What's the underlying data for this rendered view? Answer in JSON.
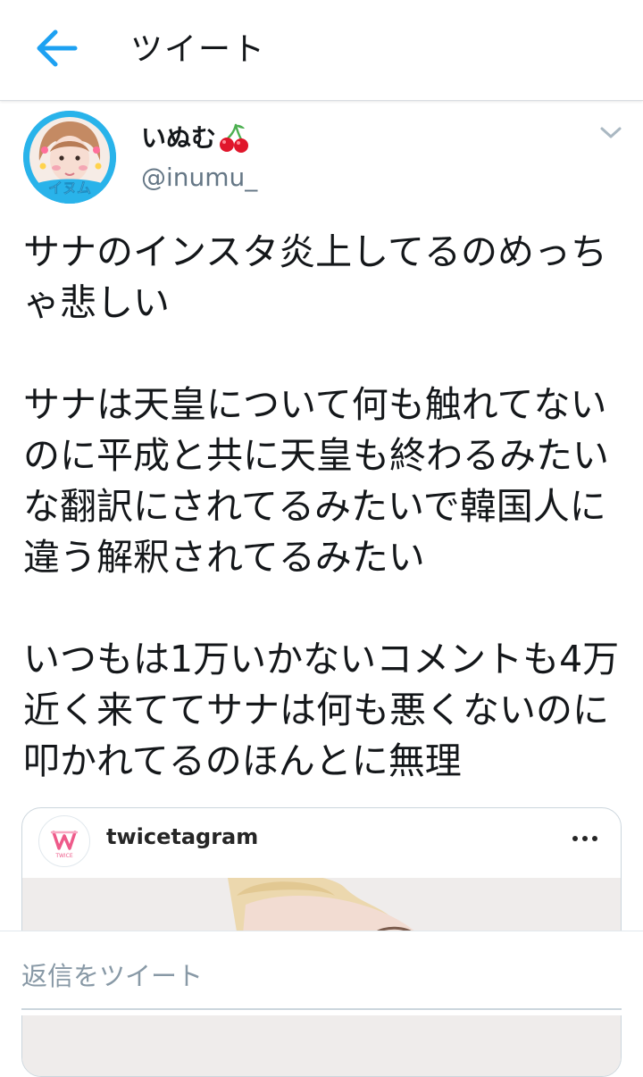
{
  "header": {
    "title": "ツイート",
    "back_icon": "back-arrow-icon",
    "accent_color": "#1da1f2"
  },
  "tweet": {
    "author": {
      "display_name": "いぬむ",
      "name_emoji_icon": "cherry-icon",
      "handle": "@inumu_",
      "avatar_overlay_text": "イヌム"
    },
    "text": "サナのインスタ炎上してるのめっちゃ悲しい\n\nサナは天皇について何も触れてないのに平成と共に天皇も終わるみたいな翻訳にされてるみたいで韓国人に違う解釈されてるみたい\n\nいつもは1万いかないコメントも4万近く来ててサナは何も悪くないのに叩かれてるのほんとに無理",
    "embed": {
      "account_name": "twicetagram",
      "logo_text": "TWICE",
      "more_icon": "more-horizontal-icon"
    }
  },
  "reply": {
    "placeholder": "返信をツイート"
  }
}
